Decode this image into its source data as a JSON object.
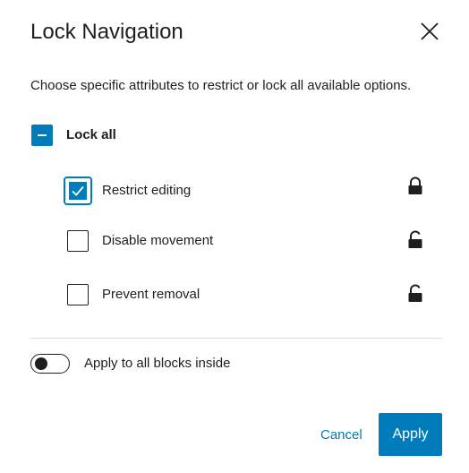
{
  "dialog": {
    "title": "Lock Navigation",
    "description": "Choose specific attributes to restrict or lock all available options."
  },
  "lock_all": {
    "label": "Lock all",
    "state": "indeterminate"
  },
  "options": [
    {
      "label": "Restrict editing",
      "checked": true,
      "lock_icon": "lock-closed-icon"
    },
    {
      "label": "Disable movement",
      "checked": false,
      "lock_icon": "lock-open-icon"
    },
    {
      "label": "Prevent removal",
      "checked": false,
      "lock_icon": "lock-open-icon"
    }
  ],
  "apply_inside": {
    "label": "Apply to all blocks inside",
    "enabled": false
  },
  "footer": {
    "cancel_label": "Cancel",
    "apply_label": "Apply"
  },
  "colors": {
    "accent": "#007cba",
    "text": "#1e1e1e",
    "divider": "#dddddd"
  }
}
